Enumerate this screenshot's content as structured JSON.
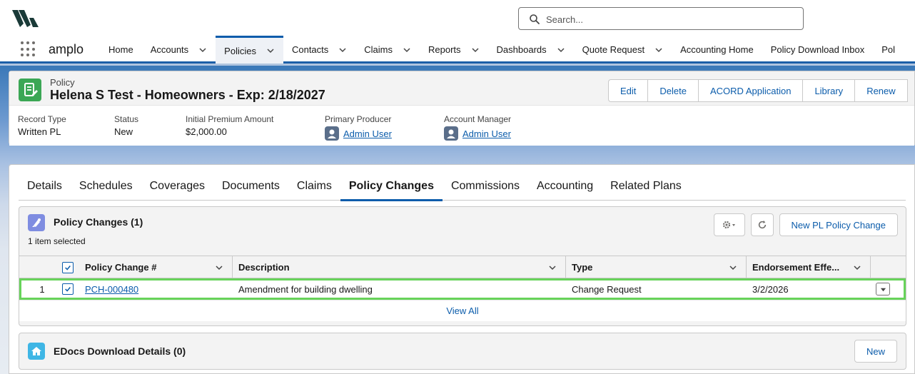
{
  "header": {
    "logo_name": "amplo-logo",
    "search_placeholder": "Search..."
  },
  "nav": {
    "app_name": "amplo",
    "items": [
      {
        "label": "Home",
        "has_menu": false
      },
      {
        "label": "Accounts",
        "has_menu": true
      },
      {
        "label": "Policies",
        "has_menu": true,
        "active": true
      },
      {
        "label": "Contacts",
        "has_menu": true
      },
      {
        "label": "Claims",
        "has_menu": true
      },
      {
        "label": "Reports",
        "has_menu": true
      },
      {
        "label": "Dashboards",
        "has_menu": true
      },
      {
        "label": "Quote Request",
        "has_menu": true
      },
      {
        "label": "Accounting Home",
        "has_menu": false
      },
      {
        "label": "Policy Download Inbox",
        "has_menu": false
      },
      {
        "label": "Pol",
        "has_menu": false
      }
    ]
  },
  "record": {
    "object_label": "Policy",
    "title": "Helena S Test - Homeowners - Exp: 2/18/2027",
    "actions": [
      "Edit",
      "Delete",
      "ACORD Application",
      "Library",
      "Renew"
    ],
    "fields": [
      {
        "label": "Record Type",
        "value": "Written PL"
      },
      {
        "label": "Status",
        "value": "New"
      },
      {
        "label": "Initial Premium Amount",
        "value": "$2,000.00"
      },
      {
        "label": "Primary Producer",
        "value": "Admin User"
      },
      {
        "label": "Account Manager",
        "value": "Admin User"
      }
    ]
  },
  "tabs": [
    "Details",
    "Schedules",
    "Coverages",
    "Documents",
    "Claims",
    "Policy Changes",
    "Commissions",
    "Accounting",
    "Related Plans"
  ],
  "active_tab": "Policy Changes",
  "policy_changes": {
    "title": "Policy Changes (1)",
    "selection_text": "1 item selected",
    "new_button": "New PL Policy Change",
    "columns": [
      "Policy Change #",
      "Description",
      "Type",
      "Endorsement Effe..."
    ],
    "rows": [
      {
        "num": "1",
        "policy_change": "PCH-000480",
        "description": "Amendment for building dwelling",
        "type": "Change Request",
        "endorsement": "3/2/2026",
        "selected": true
      }
    ],
    "view_all": "View All"
  },
  "edocs": {
    "title": "EDocs Download Details (0)",
    "new_button": "New"
  },
  "colors": {
    "brand": "#0b5cab",
    "highlight_row": "#67d35a",
    "record_icon": "#3ba755"
  }
}
